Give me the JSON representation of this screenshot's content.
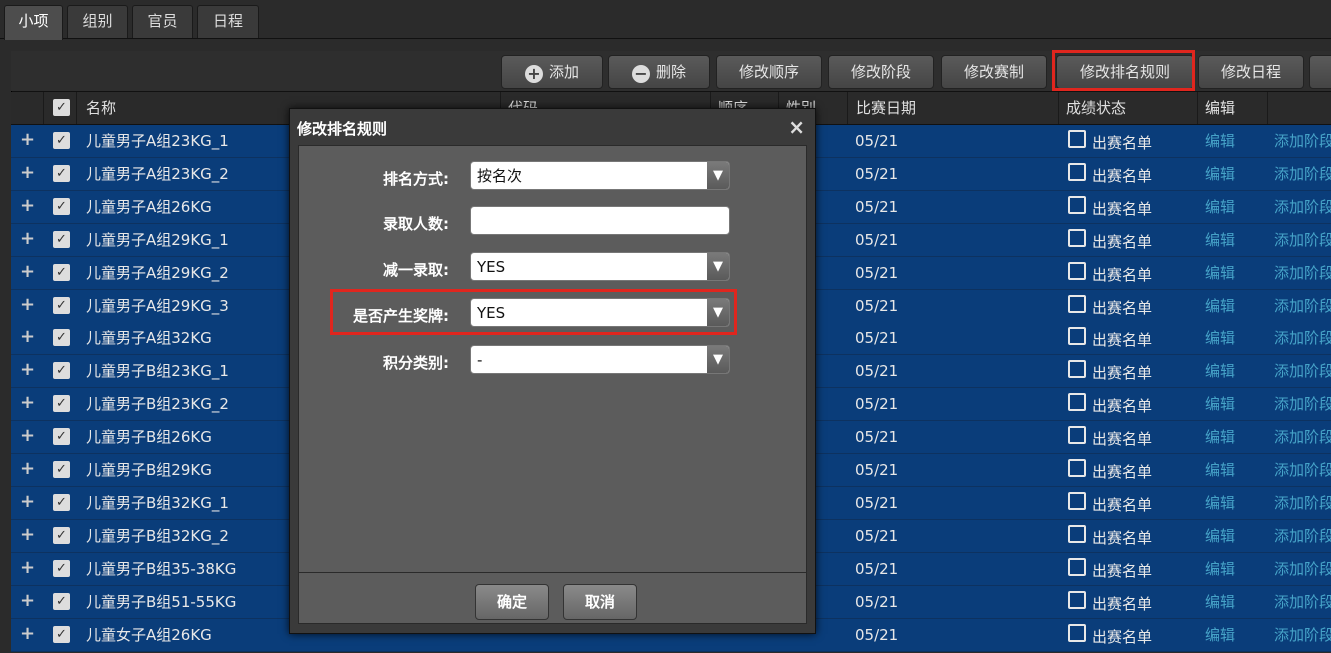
{
  "tabs": [
    "小项",
    "组别",
    "官员",
    "日程"
  ],
  "toolbar": {
    "add": "添加",
    "delete": "删除",
    "order": "修改顺序",
    "stage": "修改阶段",
    "format": "修改赛制",
    "ranking": "修改排名规则",
    "schedule": "修改日程"
  },
  "header": {
    "name": "名称",
    "code": "代码",
    "order": "顺序",
    "gender": "性别",
    "date": "比赛日期",
    "status": "成绩状态",
    "edit": "编辑"
  },
  "rows": [
    {
      "name": "儿童男子A组23KG_1",
      "date": "05/21",
      "list": "出赛名单",
      "edit": "编辑",
      "add": "添加阶段"
    },
    {
      "name": "儿童男子A组23KG_2",
      "date": "05/21",
      "list": "出赛名单",
      "edit": "编辑",
      "add": "添加阶段"
    },
    {
      "name": "儿童男子A组26KG",
      "date": "05/21",
      "list": "出赛名单",
      "edit": "编辑",
      "add": "添加阶段"
    },
    {
      "name": "儿童男子A组29KG_1",
      "date": "05/21",
      "list": "出赛名单",
      "edit": "编辑",
      "add": "添加阶段"
    },
    {
      "name": "儿童男子A组29KG_2",
      "date": "05/21",
      "list": "出赛名单",
      "edit": "编辑",
      "add": "添加阶段"
    },
    {
      "name": "儿童男子A组29KG_3",
      "date": "05/21",
      "list": "出赛名单",
      "edit": "编辑",
      "add": "添加阶段"
    },
    {
      "name": "儿童男子A组32KG",
      "date": "05/21",
      "list": "出赛名单",
      "edit": "编辑",
      "add": "添加阶段"
    },
    {
      "name": "儿童男子B组23KG_1",
      "date": "05/21",
      "list": "出赛名单",
      "edit": "编辑",
      "add": "添加阶段"
    },
    {
      "name": "儿童男子B组23KG_2",
      "date": "05/21",
      "list": "出赛名单",
      "edit": "编辑",
      "add": "添加阶段"
    },
    {
      "name": "儿童男子B组26KG",
      "date": "05/21",
      "list": "出赛名单",
      "edit": "编辑",
      "add": "添加阶段"
    },
    {
      "name": "儿童男子B组29KG",
      "date": "05/21",
      "list": "出赛名单",
      "edit": "编辑",
      "add": "添加阶段"
    },
    {
      "name": "儿童男子B组32KG_1",
      "date": "05/21",
      "list": "出赛名单",
      "edit": "编辑",
      "add": "添加阶段"
    },
    {
      "name": "儿童男子B组32KG_2",
      "date": "05/21",
      "list": "出赛名单",
      "edit": "编辑",
      "add": "添加阶段"
    },
    {
      "name": "儿童男子B组35-38KG",
      "date": "05/21",
      "list": "出赛名单",
      "edit": "编辑",
      "add": "添加阶段"
    },
    {
      "name": "儿童男子B组51-55KG",
      "date": "05/21",
      "list": "出赛名单",
      "edit": "编辑",
      "add": "添加阶段"
    },
    {
      "name": "儿童女子A组26KG",
      "date": "05/21",
      "list": "出赛名单",
      "edit": "编辑",
      "add": "添加阶段"
    }
  ],
  "dialog": {
    "title": "修改排名规则",
    "close": "×",
    "fields": {
      "rank_method_label": "排名方式:",
      "rank_method_value": "按名次",
      "admit_count_label": "录取人数:",
      "admit_count_value": "",
      "minus_one_label": "减一录取:",
      "minus_one_value": "YES",
      "medal_label": "是否产生奖牌:",
      "medal_value": "YES",
      "points_label": "积分类别:",
      "points_value": "-"
    },
    "ok": "确定",
    "cancel": "取消"
  },
  "colors": {
    "row_bg": "#0a3d7a",
    "link": "#46a3c8",
    "highlight": "#e0261e"
  }
}
